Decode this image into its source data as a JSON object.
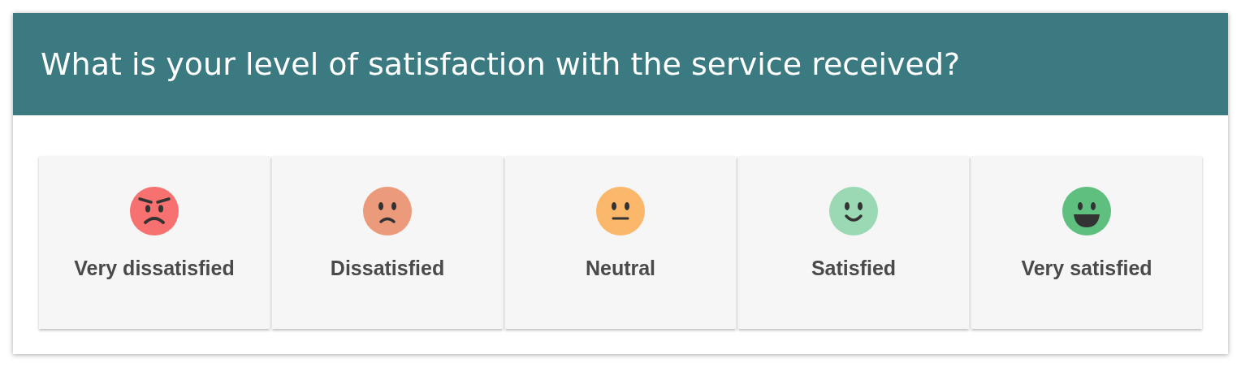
{
  "question": "What is your level of satisfaction with the service received?",
  "options": [
    {
      "label": "Very dissatisfied",
      "kind": "angry",
      "color": "#f87171"
    },
    {
      "label": "Dissatisfied",
      "kind": "sad",
      "color": "#ec9a7c"
    },
    {
      "label": "Neutral",
      "kind": "neutral",
      "color": "#fbb76a"
    },
    {
      "label": "Satisfied",
      "kind": "smile",
      "color": "#9ad9b3"
    },
    {
      "label": "Very satisfied",
      "kind": "grin",
      "color": "#5fbf7f"
    }
  ]
}
